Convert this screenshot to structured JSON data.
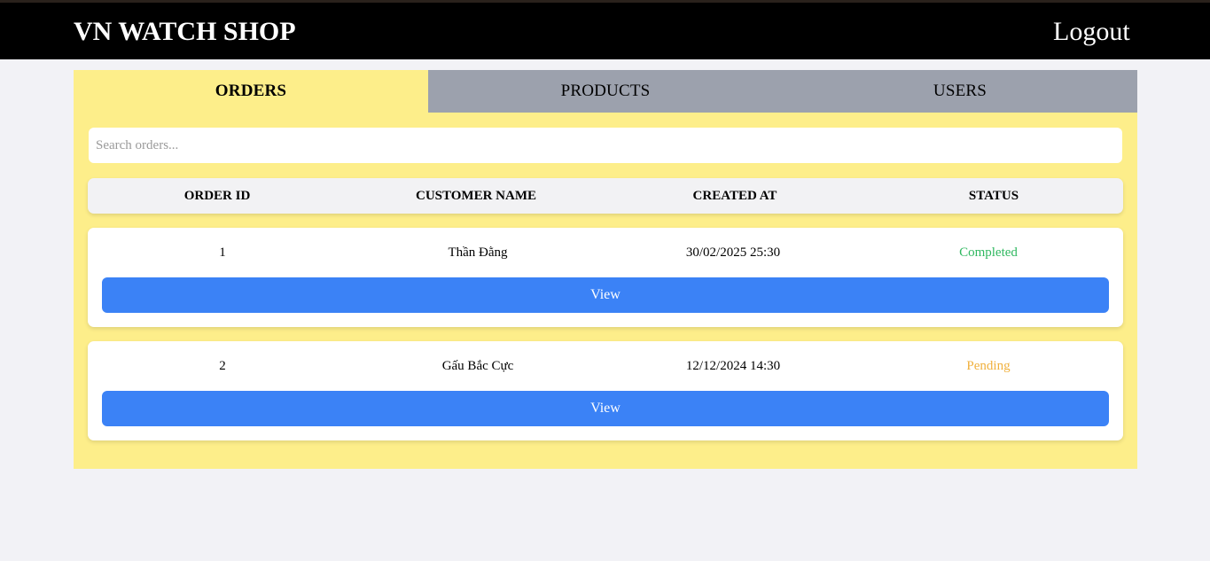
{
  "header": {
    "brand": "VN WATCH SHOP",
    "logout_label": "Logout"
  },
  "tabs": [
    {
      "label": "ORDERS",
      "active": true
    },
    {
      "label": "PRODUCTS",
      "active": false
    },
    {
      "label": "USERS",
      "active": false
    }
  ],
  "search": {
    "placeholder": "Search orders...",
    "value": ""
  },
  "table": {
    "columns": [
      "ORDER ID",
      "CUSTOMER NAME",
      "CREATED AT",
      "STATUS"
    ],
    "rows": [
      {
        "order_id": "1",
        "customer_name": "Thần Đằng",
        "created_at": "30/02/2025 25:30",
        "status": "Completed",
        "action_label": "View"
      },
      {
        "order_id": "2",
        "customer_name": "Gấu Bắc Cực",
        "created_at": "12/12/2024 14:30",
        "status": "Pending",
        "action_label": "View"
      }
    ]
  },
  "colors": {
    "topbar": "#000000",
    "panel": "#fdee8a",
    "inactive_tab": "#9ca1ad",
    "view_button": "#3b82f6",
    "status_completed": "#30b860",
    "status_pending": "#f0b03c"
  }
}
